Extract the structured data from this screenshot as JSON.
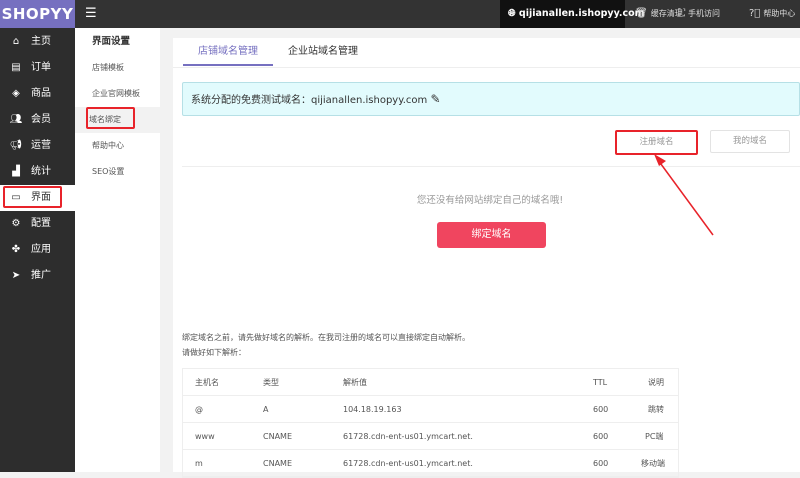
{
  "logo": "SHOPYY",
  "topbar": {
    "domain": "qijianallen.ishopyy.com",
    "items": [
      {
        "icon": "trash-icon",
        "label": "缓存清理"
      },
      {
        "icon": "mobile-scan-icon",
        "label": "手机访问"
      },
      {
        "icon": "help-circle-icon",
        "label": "帮助中心"
      }
    ]
  },
  "sidebar": {
    "items": [
      {
        "icon": "home-icon",
        "label": "主页"
      },
      {
        "icon": "order-icon",
        "label": "订单"
      },
      {
        "icon": "box-icon",
        "label": "商品"
      },
      {
        "icon": "users-icon",
        "label": "会员"
      },
      {
        "icon": "megaphone-icon",
        "label": "运营"
      },
      {
        "icon": "chart-icon",
        "label": "统计"
      },
      {
        "icon": "layout-icon",
        "label": "界面"
      },
      {
        "icon": "gear-icon",
        "label": "配置"
      },
      {
        "icon": "puzzle-icon",
        "label": "应用"
      },
      {
        "icon": "send-icon",
        "label": "推广"
      }
    ]
  },
  "submenu": {
    "title": "界面设置",
    "items": [
      "店铺模板",
      "企业官网模板",
      "域名绑定",
      "帮助中心",
      "SEO设置"
    ]
  },
  "tabs": [
    "店铺域名管理",
    "企业站域名管理"
  ],
  "info": {
    "label": "系统分配的免费测试域名：",
    "domain": "qijianallen.ishopyy.com"
  },
  "buttons": {
    "register": "注册域名",
    "my_domains": "我的域名",
    "bind": "绑定域名"
  },
  "empty_text": "您还没有给网站绑定自己的域名哦!",
  "notes": [
    "绑定域名之前，请先做好域名的解析。在我司注册的域名可以直接绑定自动解析。",
    "请做好如下解析："
  ],
  "table": {
    "headers": [
      "主机名",
      "类型",
      "解析值",
      "TTL",
      "说明"
    ],
    "rows": [
      [
        "@",
        "A",
        "104.18.19.163",
        "600",
        "跳转"
      ],
      [
        "www",
        "CNAME",
        "61728.cdn-ent-us01.ymcart.net.",
        "600",
        "PC端"
      ],
      [
        "m",
        "CNAME",
        "61728.cdn-ent-us01.ymcart.net.",
        "600",
        "移动端"
      ]
    ]
  }
}
